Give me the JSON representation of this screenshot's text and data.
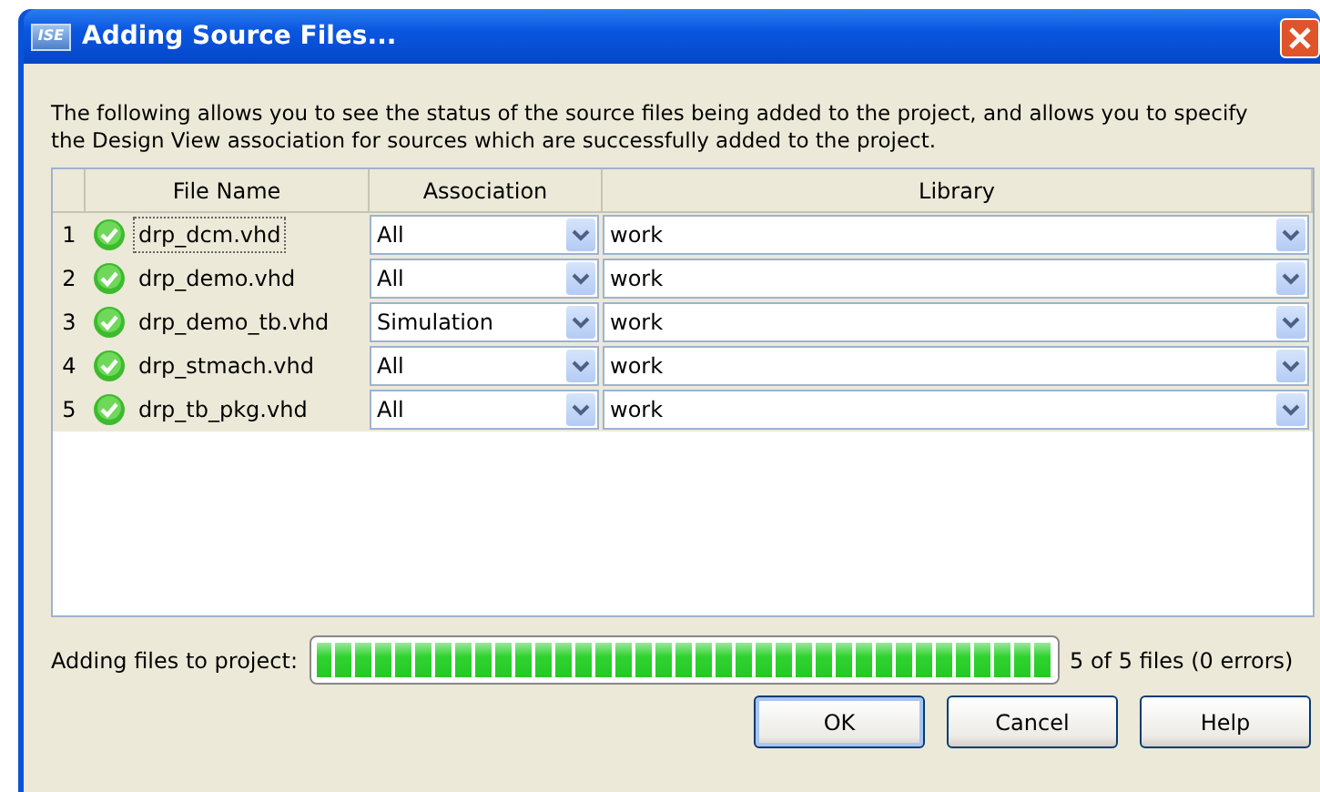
{
  "window": {
    "title": "Adding Source Files...",
    "icon_label": "ISE"
  },
  "description": "The following allows you to see the status of the source files being added to the project, and allows you to specify the Design View association for sources which are successfully added to the project.",
  "table": {
    "columns": [
      "",
      "File Name",
      "Association",
      "Library"
    ],
    "rows": [
      {
        "number": "1",
        "added": true,
        "file": "drp_dcm.vhd",
        "focused": true,
        "association": "All",
        "library": "work"
      },
      {
        "number": "2",
        "added": true,
        "file": "drp_demo.vhd",
        "focused": false,
        "association": "All",
        "library": "work"
      },
      {
        "number": "3",
        "added": true,
        "file": "drp_demo_tb.vhd",
        "focused": false,
        "association": "Simulation",
        "library": "work"
      },
      {
        "number": "4",
        "added": true,
        "file": "drp_stmach.vhd",
        "focused": false,
        "association": "All",
        "library": "work"
      },
      {
        "number": "5",
        "added": true,
        "file": "drp_tb_pkg.vhd",
        "focused": false,
        "association": "All",
        "library": "work"
      }
    ]
  },
  "progress": {
    "label": "Adding files to project:",
    "level": 1.0,
    "reading": "5 of 5 files (0 errors)"
  },
  "buttons": [
    {
      "label": "OK",
      "default": true
    },
    {
      "label": "Cancel",
      "default": false
    },
    {
      "label": "Help",
      "default": false
    }
  ]
}
